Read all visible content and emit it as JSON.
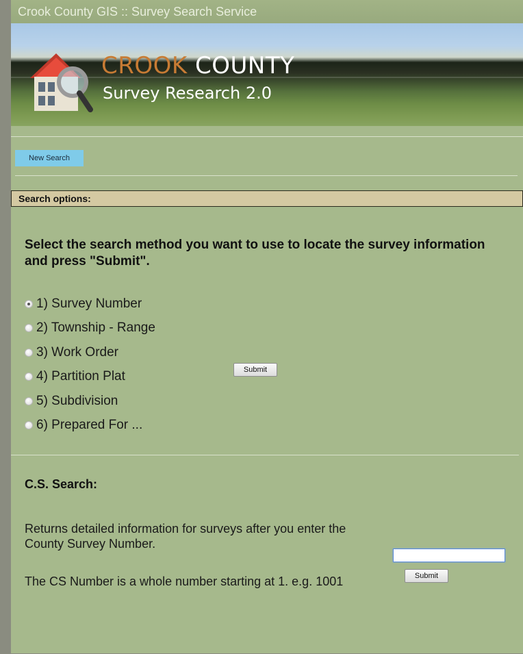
{
  "window": {
    "title": "Crook County GIS :: Survey Search Service"
  },
  "banner": {
    "brand_part1": "CROOK",
    "brand_part2": " COUNTY",
    "subtitle": "Survey Research 2.0",
    "logo_icon": "house-magnifier-icon"
  },
  "nav": {
    "new_search_label": "New Search"
  },
  "options": {
    "header": "Search options:",
    "prompt": "Select the search method you want to use to locate the survey information and press \"Submit\".",
    "methods": [
      {
        "label": "1) Survey Number",
        "selected": true
      },
      {
        "label": "2) Township - Range",
        "selected": false
      },
      {
        "label": "3) Work Order",
        "selected": false
      },
      {
        "label": "4) Partition Plat",
        "selected": false
      },
      {
        "label": "5) Subdivision",
        "selected": false
      },
      {
        "label": "6) Prepared For ...",
        "selected": false
      }
    ],
    "submit_label": "Submit"
  },
  "cs_search": {
    "title": "C.S. Search:",
    "description": "Returns detailed information for surveys after you enter the County Survey Number.",
    "hint": "The CS Number is a whole number starting at 1. e.g. 1001",
    "input_value": "",
    "submit_label": "Submit"
  },
  "colors": {
    "page_bg": "#a6b98c",
    "title_text": "#e8eedc",
    "new_search_bg": "#7fcbe9",
    "options_bar_bg": "#d4c9a2",
    "brand_accent": "#c77b34"
  }
}
